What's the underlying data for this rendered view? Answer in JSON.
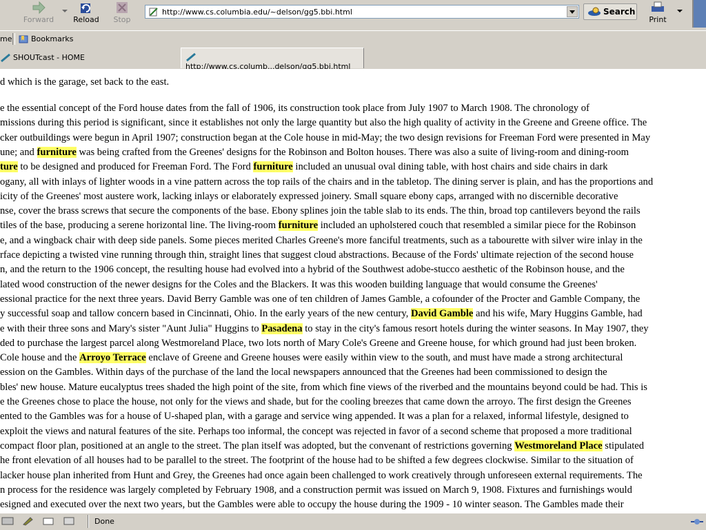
{
  "toolbar": {
    "forward_label": "Forward",
    "reload_label": "Reload",
    "stop_label": "Stop",
    "url": "http://www.cs.columbia.edu/~delson/gg5.bbi.html",
    "search_label": "Search",
    "print_label": "Print"
  },
  "bookmarks": {
    "left_label": "me",
    "bookmarks_label": "Bookmarks"
  },
  "tabs": [
    {
      "label": "SHOUTcast - HOME"
    },
    {
      "label": "http://www.cs.columb...delson/gg5.bbi.html"
    }
  ],
  "content": {
    "top_line": "d which is the garage, set back to the east.",
    "lines": [
      [
        {
          "t": "e the essential concept of the Ford house dates from the fall of 1906, its construction took place from July 1907 to March 1908. The chronology of"
        }
      ],
      [
        {
          "t": "missions during this period is significant, since it establishes not only the large quantity but also the high quality of activity in the Greene and Greene office. The"
        }
      ],
      [
        {
          "t": "cker outbuildings were begun in April 1907; construction began at the Cole house in mid-May; the two design revisions for Freeman Ford were presented in May"
        }
      ],
      [
        {
          "t": "une; and "
        },
        {
          "t": "furniture",
          "h": true
        },
        {
          "t": " was being crafted from the Greenes' designs for the Robinson and Bolton houses. There was also a suite of living-room and dining-room"
        }
      ],
      [
        {
          "t": "ture",
          "h": true
        },
        {
          "t": " to be designed and produced for Freeman Ford. The Ford "
        },
        {
          "t": "furniture",
          "h": true
        },
        {
          "t": " included an unusual oval dining table, with host chairs and side chairs in dark"
        }
      ],
      [
        {
          "t": "ogany, all with inlays of lighter woods in a vine pattern across the top rails of the chairs and in the tabletop. The dining server is plain, and has the proportions and"
        }
      ],
      [
        {
          "t": "icity of the Greenes' most austere work, lacking inlays or elaborately expressed joinery. Small square ebony caps, arranged with no discernible decorative"
        }
      ],
      [
        {
          "t": "nse, cover the brass screws that secure the components of the base. Ebony splines join the table slab to its ends. The thin, broad top cantilevers beyond the rails"
        }
      ],
      [
        {
          "t": "tiles of the base, producing a serene horizontal line. The living-room "
        },
        {
          "t": "furniture",
          "h": true
        },
        {
          "t": " included an upholstered couch that resembled a similar piece for the Robinson"
        }
      ],
      [
        {
          "t": "e, and a wingback chair with deep side panels. Some pieces merited Charles Greene's more fanciful treatments, such as a tabourette with silver wire inlay in the"
        }
      ],
      [
        {
          "t": "rface depicting a twisted vine running through thin, straight lines that suggest cloud abstractions. Because of the Fords' ultimate rejection of the second house"
        }
      ],
      [
        {
          "t": "n, and the return to the 1906 concept, the resulting house had evolved into a hybrid of the Southwest adobe-stucco aesthetic of the Robinson house, and the"
        }
      ],
      [
        {
          "t": "lated wood construction of the newer designs for the Coles and the Blackers. It was this wooden building language that would consume the Greenes'"
        }
      ],
      [
        {
          "t": "essional practice for the next three years. David Berry Gamble was one of ten children of James Gamble, a cofounder of the Procter and Gamble Company, the"
        }
      ],
      [
        {
          "t": "y successful soap and tallow concern based in Cincinnati, Ohio. In the early years of the new century, "
        },
        {
          "t": "David Gamble",
          "h": true
        },
        {
          "t": " and his wife, Mary Huggins Gamble, had"
        }
      ],
      [
        {
          "t": "e with their three sons and Mary's sister \"Aunt Julia\" Huggins to "
        },
        {
          "t": "Pasadena",
          "h": true
        },
        {
          "t": " to stay in the city's famous resort hotels during the winter seasons. In May 1907, they"
        }
      ],
      [
        {
          "t": "ded to purchase the largest parcel along Westmoreland Place, two lots north of Mary Cole's Greene and Greene house, for which ground had just been broken."
        }
      ],
      [
        {
          "t": "Cole house and the "
        },
        {
          "t": "Arroyo Terrace",
          "h": true
        },
        {
          "t": " enclave of Greene and Greene houses were easily within view to the south, and must have made a strong architectural"
        }
      ],
      [
        {
          "t": "ession on the Gambles. Within days of the purchase of the land the local newspapers announced that the Greenes had been commissioned to design the"
        }
      ],
      [
        {
          "t": "bles' new house. Mature eucalyptus trees shaded the high point of the site, from which fine views of the riverbed and the mountains beyond could be had. This is"
        }
      ],
      [
        {
          "t": "e the Greenes chose to place the house, not only for the views and shade, but for the cooling breezes that came down the arroyo. The first design the Greenes"
        }
      ],
      [
        {
          "t": "ented to the Gambles was for a house of U-shaped plan, with a garage and service wing appended. It was a plan for a relaxed, informal lifestyle, designed to"
        }
      ],
      [
        {
          "t": "exploit the views and natural features of the site. Perhaps too informal, the concept was rejected in favor of a second scheme that proposed a more traditional"
        }
      ],
      [
        {
          "t": "compact floor plan, positioned at an angle to the street. The plan itself was adopted, but the convenant of restrictions governing "
        },
        {
          "t": "Westmoreland Place",
          "h": true
        },
        {
          "t": " stipulated"
        }
      ],
      [
        {
          "t": "he front elevation of all houses had to be parallel to the street. The footprint of the house had to be shifted a few degrees clockwise. Similar to the situation of"
        }
      ],
      [
        {
          "t": "lacker house plan inherited from Hunt and Grey, the Greenes had once again been challenged to work creatively through unforeseen external requirements. The"
        }
      ],
      [
        {
          "t": "n process for the residence was largely completed by February 1908, and a construction permit was issued on March 9, 1908. Fixtures and furnishings would"
        }
      ],
      [
        {
          "t": "esigned and executed over the next two years, but the Gambles were able to occupy the house during the 1909 - 10 winter season. The Gambles made their"
        }
      ]
    ]
  },
  "status": {
    "text": "Done"
  },
  "colors": {
    "highlight": "#ffff66",
    "chrome": "#d4d0c8"
  }
}
